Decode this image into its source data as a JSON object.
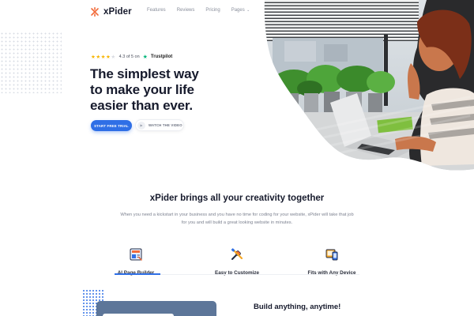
{
  "brand": {
    "name": "xPider",
    "accent": "#f26b3a",
    "primary": "#2f6fe6"
  },
  "nav": {
    "items": [
      "Features",
      "Reviews",
      "Pricing"
    ],
    "dropdown_label": "Pages"
  },
  "hero": {
    "rating_text": "4.3 of 5 on",
    "rating_value": 4.3,
    "rating_source": "Trustpilot",
    "headline": [
      "The simplest way",
      "to make your life",
      "easier than ever."
    ],
    "cta_primary": "START FREE TRIAL",
    "cta_secondary": "WATCH THE VIDEO"
  },
  "features": {
    "title": "xPider brings all your creativity together",
    "description": "When you need a kickstart in your business and you have no time for coding for your website, xPider will take that job for you and will build a great looking website in minutes.",
    "tabs": [
      {
        "label": "AI Page Builder",
        "icon": "page-builder-icon",
        "active": true
      },
      {
        "label": "Easy to Customize",
        "icon": "tools-icon",
        "active": false
      },
      {
        "label": "Fits with Any Device",
        "icon": "devices-icon",
        "active": false
      }
    ]
  },
  "bottom": {
    "heading": "Build anything, anytime!"
  }
}
